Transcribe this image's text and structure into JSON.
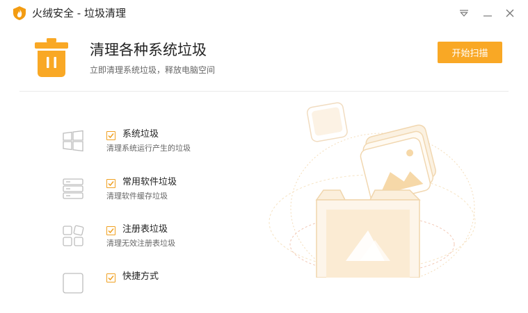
{
  "window": {
    "title": "火绒安全 - 垃圾清理",
    "controls": [
      "menu-icon",
      "minimize-icon",
      "close-icon"
    ]
  },
  "header": {
    "title": "清理各种系统垃圾",
    "subtitle": "立即清理系统垃圾，释放电脑空间",
    "scan_button": "开始扫描",
    "icon": "trash-icon"
  },
  "items": [
    {
      "icon": "windows-icon",
      "checked": true,
      "title": "系统垃圾",
      "desc": "清理系统运行产生的垃圾"
    },
    {
      "icon": "storage-icon",
      "checked": true,
      "title": "常用软件垃圾",
      "desc": "清理软件缓存垃圾"
    },
    {
      "icon": "registry-icon",
      "checked": true,
      "title": "注册表垃圾",
      "desc": "清理无效注册表垃圾"
    },
    {
      "icon": "shortcut-icon",
      "checked": true,
      "title": "快捷方式",
      "desc": ""
    }
  ],
  "colors": {
    "accent": "#f9a825",
    "checkbox": "#f0a020",
    "title_text": "#222222",
    "sub_text": "#666666",
    "icon_gray": "#bdbdbd",
    "illustration": "#f3d7a6"
  }
}
